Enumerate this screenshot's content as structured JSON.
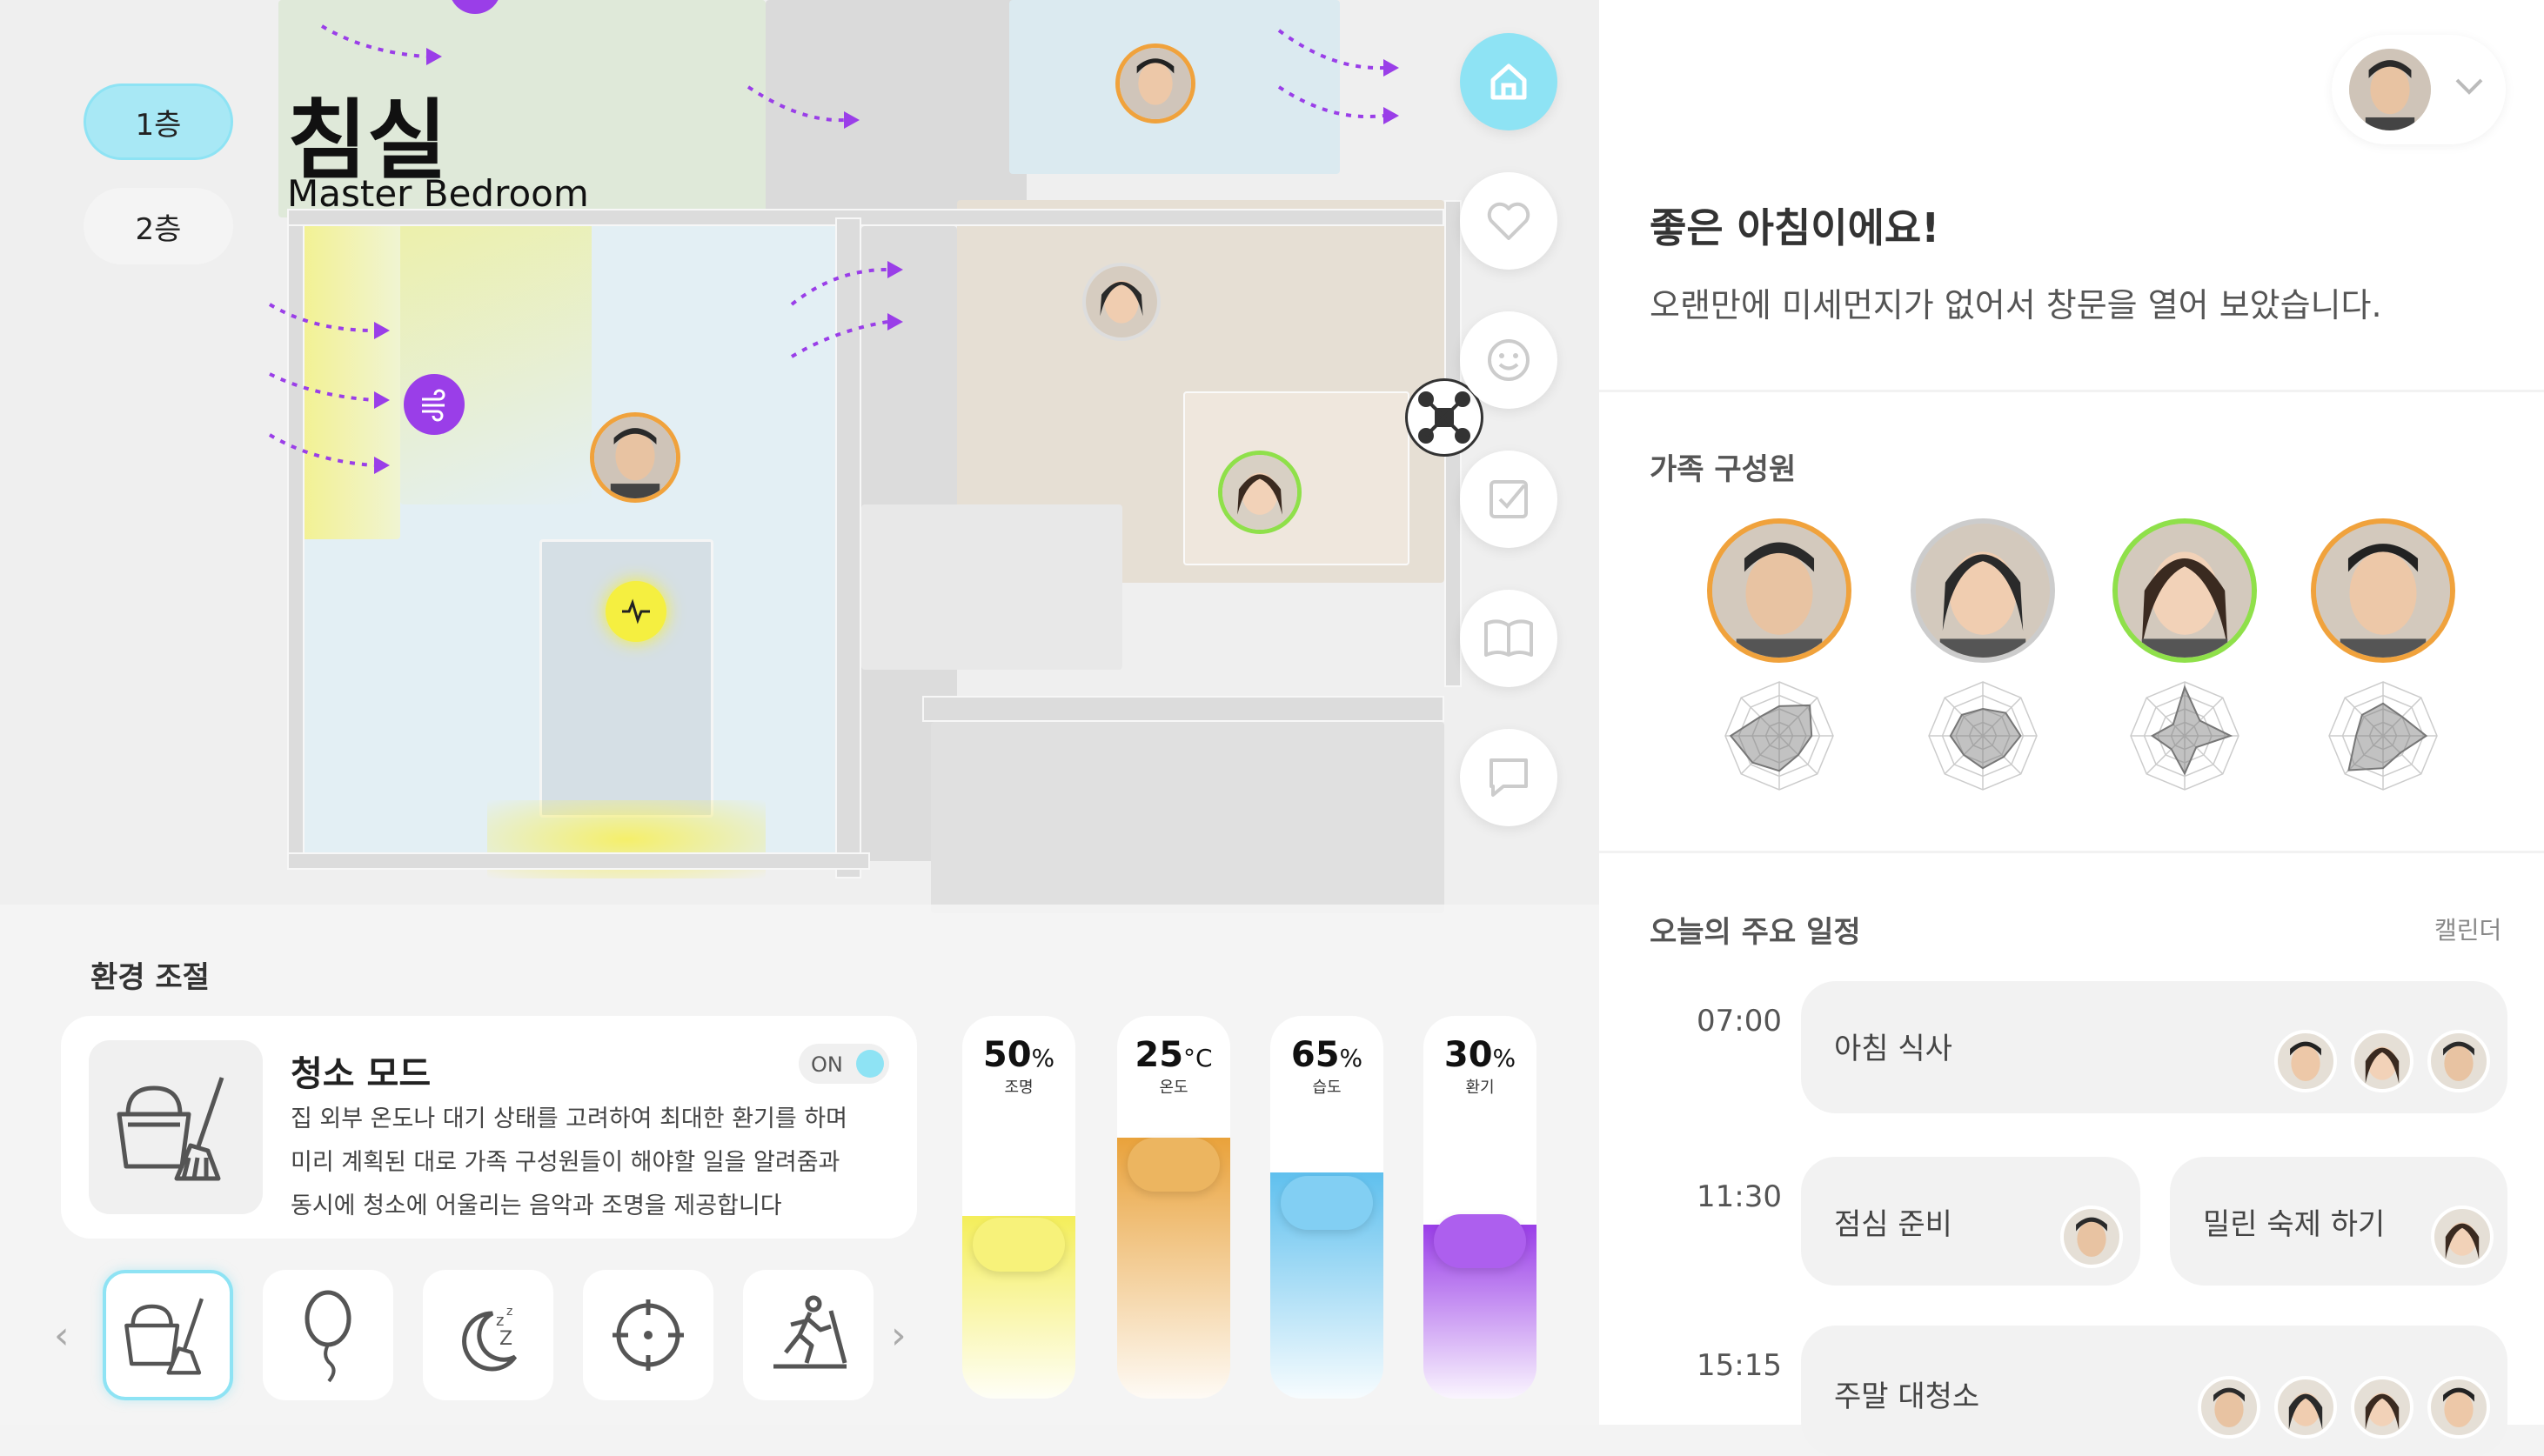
{
  "floors": [
    "1층",
    "2층"
  ],
  "room": {
    "title_ko": "침실",
    "title_en": "Master Bedroom"
  },
  "env": {
    "title": "환경 조절",
    "mode_title": "청소 모드",
    "toggle_label": "ON",
    "mode_desc": [
      "집 외부 온도나 대기 상태를 고려하여 최대한 환기를 하며",
      "미리 계획된 대로 가족 구성원들이 해야할 일을 알려줌과",
      "동시에 청소에 어울리는 음악과 조명을 제공합니다"
    ],
    "modes": [
      "cleaning-icon",
      "balloon-icon",
      "sleep-icon",
      "target-icon",
      "treadmill-icon"
    ],
    "sliders": [
      {
        "value": "50",
        "unit": "%",
        "label": "조명",
        "level": 0.5,
        "color": "#f4ee5a"
      },
      {
        "value": "25",
        "unit": "°C",
        "label": "온도",
        "level": 0.25,
        "color": "#e9a23b"
      },
      {
        "value": "65",
        "unit": "%",
        "label": "습도",
        "level": 0.65,
        "color": "#5fc0ee"
      },
      {
        "value": "30",
        "unit": "%",
        "label": "환기",
        "level": 0.3,
        "color": "#9a3ee8"
      }
    ]
  },
  "greeting": {
    "title": "좋은 아침이에요!",
    "message": "오랜만에 미세먼지가 없어서 창문을 열어 보았습니다."
  },
  "family": {
    "title": "가족 구성원",
    "members": [
      {
        "name": "father",
        "ring": "#f0a23c"
      },
      {
        "name": "mother",
        "ring": "#cccccc"
      },
      {
        "name": "daughter",
        "ring": "#8fe04a"
      },
      {
        "name": "son",
        "ring": "#f0a23c"
      }
    ]
  },
  "schedule": {
    "title": "오늘의 주요 일정",
    "calendar_link": "캘린더",
    "times": [
      "07:00",
      "11:30",
      "15:15"
    ],
    "events": [
      "아침 식사",
      "점심 준비",
      "밀린 숙제 하기",
      "주말 대청소"
    ]
  },
  "colors": {
    "accent": "#8ee3f4",
    "purple": "#9a3ee8",
    "yellow": "#f4ee5a"
  }
}
